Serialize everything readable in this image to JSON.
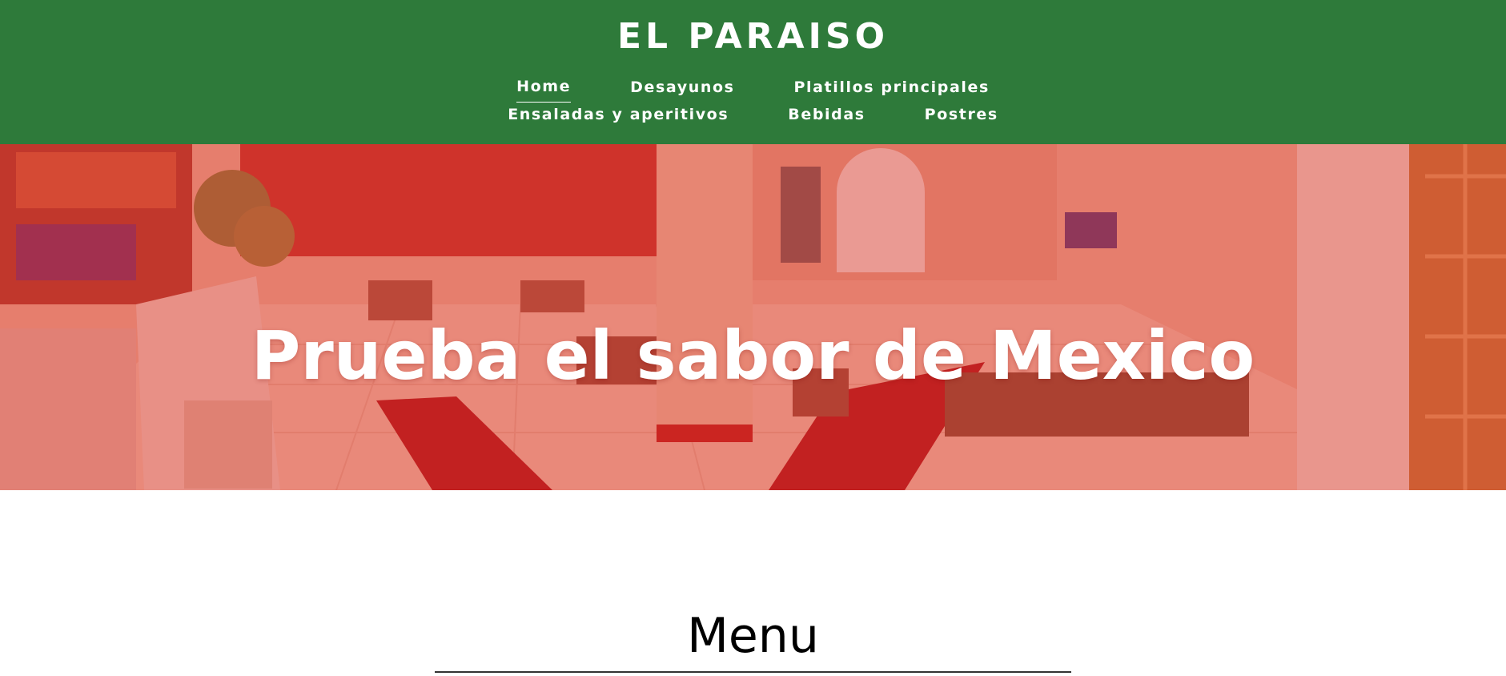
{
  "header": {
    "brand": "EL PARAISO",
    "nav_row1": [
      "Home",
      "Desayunos",
      "Platillos principales"
    ],
    "nav_row2": [
      "Ensaladas y aperitivos",
      "Bebidas",
      "Postres"
    ],
    "active_item": "Home"
  },
  "hero": {
    "title": "Prueba el sabor de Mexico",
    "image": "restaurant-interior-photo"
  },
  "menu": {
    "title": "Menu"
  },
  "colors": {
    "header_bg": "#2e7a3a",
    "hero_overlay": "#d9342b",
    "text_light": "#ffffff",
    "text_dark": "#000000"
  }
}
